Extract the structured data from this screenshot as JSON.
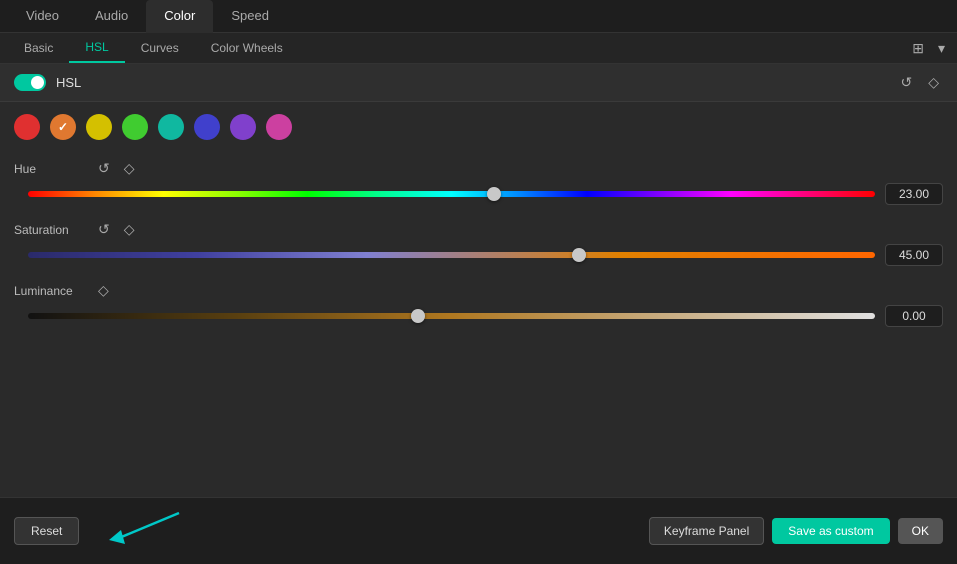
{
  "topTabs": [
    {
      "id": "video",
      "label": "Video",
      "active": false
    },
    {
      "id": "audio",
      "label": "Audio",
      "active": false
    },
    {
      "id": "color",
      "label": "Color",
      "active": true
    },
    {
      "id": "speed",
      "label": "Speed",
      "active": false
    }
  ],
  "subTabs": [
    {
      "id": "basic",
      "label": "Basic",
      "active": false
    },
    {
      "id": "hsl",
      "label": "HSL",
      "active": true
    },
    {
      "id": "curves",
      "label": "Curves",
      "active": false
    },
    {
      "id": "colorwheels",
      "label": "Color Wheels",
      "active": false
    }
  ],
  "hslSection": {
    "toggleLabel": "HSL",
    "enabled": true
  },
  "colorCircles": [
    {
      "id": "red",
      "color": "#e03030",
      "selected": false
    },
    {
      "id": "orange",
      "color": "#e07830",
      "selected": true
    },
    {
      "id": "yellow",
      "color": "#d4c000",
      "selected": false
    },
    {
      "id": "green",
      "color": "#40cc30",
      "selected": false
    },
    {
      "id": "teal",
      "color": "#10b8a0",
      "selected": false
    },
    {
      "id": "blue",
      "color": "#4040cc",
      "selected": false
    },
    {
      "id": "purple",
      "color": "#8040cc",
      "selected": false
    },
    {
      "id": "magenta",
      "color": "#cc40a0",
      "selected": false
    }
  ],
  "sliders": {
    "hue": {
      "label": "Hue",
      "value": 23.0,
      "valueDisplay": "23.00",
      "percent": 55
    },
    "saturation": {
      "label": "Saturation",
      "value": 45.0,
      "valueDisplay": "45.00",
      "percent": 65
    },
    "luminance": {
      "label": "Luminance",
      "value": 0.0,
      "valueDisplay": "0.00",
      "percent": 46
    }
  },
  "bottomBar": {
    "resetLabel": "Reset",
    "keyframeLabel": "Keyframe Panel",
    "saveCustomLabel": "Save as custom",
    "okLabel": "OK"
  }
}
